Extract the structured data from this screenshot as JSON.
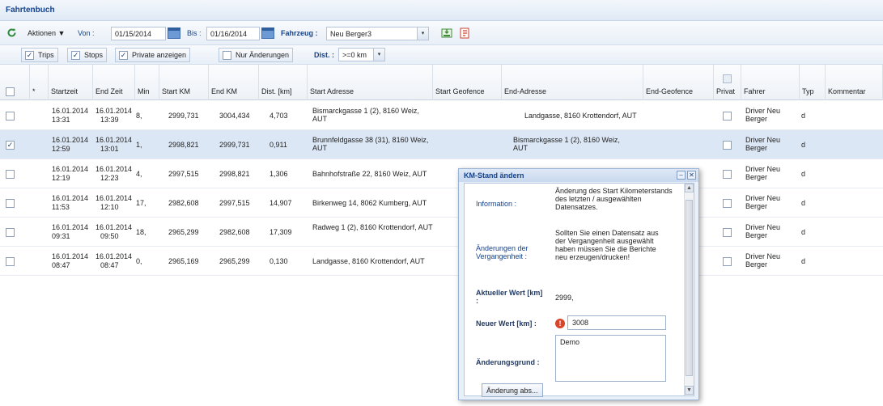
{
  "window": {
    "title": "Fahrtenbuch"
  },
  "toolbar": {
    "aktionen_label": "Aktionen ▼",
    "von_label": "Von :",
    "von_value": "01/15/2014",
    "bis_label": "Bis :",
    "bis_value": "01/16/2014",
    "fahrzeug_label": "Fahrzeug :",
    "fahrzeug_value": "Neu Berger3"
  },
  "filters": {
    "trips_label": "Trips",
    "trips_checked": true,
    "stops_label": "Stops",
    "stops_checked": true,
    "private_label": "Private anzeigen",
    "private_checked": true,
    "changes_label": "Nur Änderungen",
    "changes_checked": false,
    "dist_label": "Dist. :",
    "dist_value": ">=0 km"
  },
  "columns": [
    "*",
    "Startzeit",
    "End Zeit",
    "Min",
    "Start KM",
    "End KM",
    "Dist. [km]",
    "Start Adresse",
    "Start Geofence",
    "End-Adresse",
    "End-Geofence",
    "Privat",
    "Fahrer",
    "Typ",
    "Kommentar"
  ],
  "rows": [
    {
      "start_date": "16.01.2014",
      "start_time": "13:31",
      "end_date": "16.01.2014",
      "end_time": "13:39",
      "min": "8,",
      "start_km": "2999,731",
      "end_km": "3004,434",
      "dist": "4,703",
      "start_addr": "Bismarckgasse 1 (2), 8160 Weiz, AUT",
      "end_addr": "Landgasse, 8160 Krottendorf, AUT",
      "fahrer": "Driver Neu Berger",
      "typ": "d",
      "selected": false
    },
    {
      "start_date": "16.01.2014",
      "start_time": "12:59",
      "end_date": "16.01.2014",
      "end_time": "13:01",
      "min": "1,",
      "start_km": "2998,821",
      "end_km": "2999,731",
      "dist": "0,911",
      "start_addr": "Brunnfeldgasse 38 (31), 8160 Weiz, AUT",
      "end_addr": "Bismarckgasse 1 (2), 8160 Weiz, AUT",
      "fahrer": "Driver Neu Berger",
      "typ": "d",
      "selected": true
    },
    {
      "start_date": "16.01.2014",
      "start_time": "12:19",
      "end_date": "16.01.2014",
      "end_time": "12:23",
      "min": "4,",
      "start_km": "2997,515",
      "end_km": "2998,821",
      "dist": "1,306",
      "start_addr": "Bahnhofstraße 22, 8160 Weiz, AUT",
      "end_addr": "",
      "fahrer": "Driver Neu Berger",
      "typ": "d",
      "selected": false
    },
    {
      "start_date": "16.01.2014",
      "start_time": "11:53",
      "end_date": "16.01.2014",
      "end_time": "12:10",
      "min": "17,",
      "start_km": "2982,608",
      "end_km": "2997,515",
      "dist": "14,907",
      "start_addr": "Birkenweg 14, 8062 Kumberg, AUT",
      "end_addr": "",
      "fahrer": "Driver Neu Berger",
      "typ": "d",
      "selected": false
    },
    {
      "start_date": "16.01.2014",
      "start_time": "09:31",
      "end_date": "16.01.2014",
      "end_time": "09:50",
      "min": "18,",
      "start_km": "2965,299",
      "end_km": "2982,608",
      "dist": "17,309",
      "start_addr": "Radweg 1 (2), 8160 Krottendorf, AUT",
      "end_addr": "",
      "fahrer": "Driver Neu Berger",
      "typ": "d",
      "selected": false
    },
    {
      "start_date": "16.01.2014",
      "start_time": "08:47",
      "end_date": "16.01.2014",
      "end_time": "08:47",
      "min": "0,",
      "start_km": "2965,169",
      "end_km": "2965,299",
      "dist": "0,130",
      "start_addr": "Landgasse, 8160 Krottendorf, AUT",
      "end_addr": "",
      "fahrer": "Driver Neu Berger",
      "typ": "d",
      "selected": false
    }
  ],
  "dialog": {
    "title": "KM-Stand ändern",
    "info_label": "Information :",
    "info_text": "Änderung des Start Kilometerstands des letzten / ausgewählten Datensatzes.",
    "vergangenheit_label": "Änderungen der Vergangenheit :",
    "vergangenheit_text": "Sollten Sie einen Datensatz aus der Vergangenheit ausgewählt haben müssen Sie die Berichte neu erzeugen/drucken!",
    "aktuell_label": "Aktueller Wert [km] :",
    "aktuell_value": "2999,",
    "neu_label": "Neuer Wert [km] :",
    "neu_value": "3008",
    "grund_label": "Änderungsgrund :",
    "grund_value": "Demo",
    "save_button": "Änderung abs..."
  }
}
